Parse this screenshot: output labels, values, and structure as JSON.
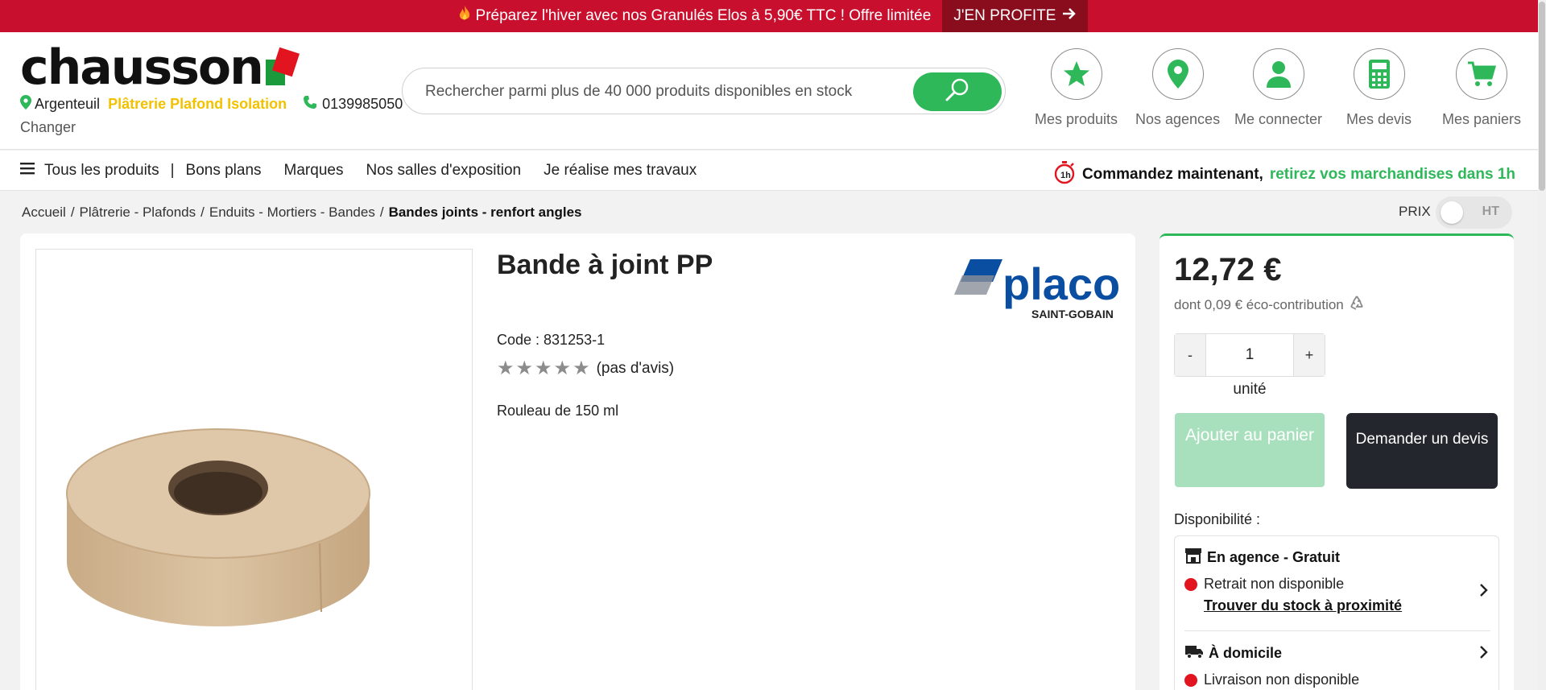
{
  "promo": {
    "text": "Préparez l'hiver avec nos Granulés Elos à 5,90€ TTC ! Offre limitée",
    "cta": "J'EN PROFITE",
    "color": "#c8102e"
  },
  "header": {
    "logo_text": "chausson",
    "location": {
      "city": "Argenteuil",
      "category": "Plâtrerie Plafond Isolation",
      "phone": "0139985050",
      "change_label": "Changer"
    },
    "search": {
      "placeholder": "Rechercher parmi plus de 40 000 produits disponibles en stock"
    },
    "nav": [
      {
        "label": "Mes produits",
        "icon": "star-icon"
      },
      {
        "label": "Nos agences",
        "icon": "map-pin-icon"
      },
      {
        "label": "Me connecter",
        "icon": "user-icon"
      },
      {
        "label": "Mes devis",
        "icon": "calculator-icon"
      },
      {
        "label": "Mes paniers",
        "icon": "cart-icon"
      }
    ]
  },
  "menu": {
    "all_products": "Tous les produits",
    "separator": "|",
    "items": [
      "Bons plans",
      "Marques",
      "Nos salles d'exposition",
      "Je réalise mes travaux"
    ],
    "promo_bold": "Commandez maintenant,",
    "promo_green": "retirez vos marchandises dans 1h"
  },
  "breadcrumb": {
    "items": [
      "Accueil",
      "Plâtrerie - Plafonds",
      "Enduits - Mortiers - Bandes"
    ],
    "current": "Bandes joints - renfort angles",
    "sep": "/"
  },
  "price_toggle": {
    "label": "PRIX",
    "value": "HT"
  },
  "product": {
    "title": "Bande à joint PP",
    "brand": {
      "name": "placo",
      "sub": "SAINT-GOBAIN"
    },
    "code": "Code : 831253-1",
    "rating_stars": 5,
    "rating_label": "(pas d'avis)",
    "description": "Rouleau de 150 ml"
  },
  "buy": {
    "price": "12,72 €",
    "eco": "dont 0,09 € éco-contribution",
    "qty_minus": "-",
    "qty_value": "1",
    "qty_plus": "+",
    "unit": "unité",
    "add_to_cart": "Ajouter au panier",
    "request_quote": "Demander un devis",
    "availability_label": "Disponibilité :",
    "pickup": {
      "title": "En agence - Gratuit",
      "status": "Retrait non disponible",
      "link": "Trouver du stock à proximité"
    },
    "delivery": {
      "title": "À domicile",
      "status": "Livraison non disponible"
    }
  },
  "colors": {
    "green": "#2fb85a",
    "red": "#e2141f",
    "dark": "#23272d",
    "yellow": "#f2c200"
  }
}
